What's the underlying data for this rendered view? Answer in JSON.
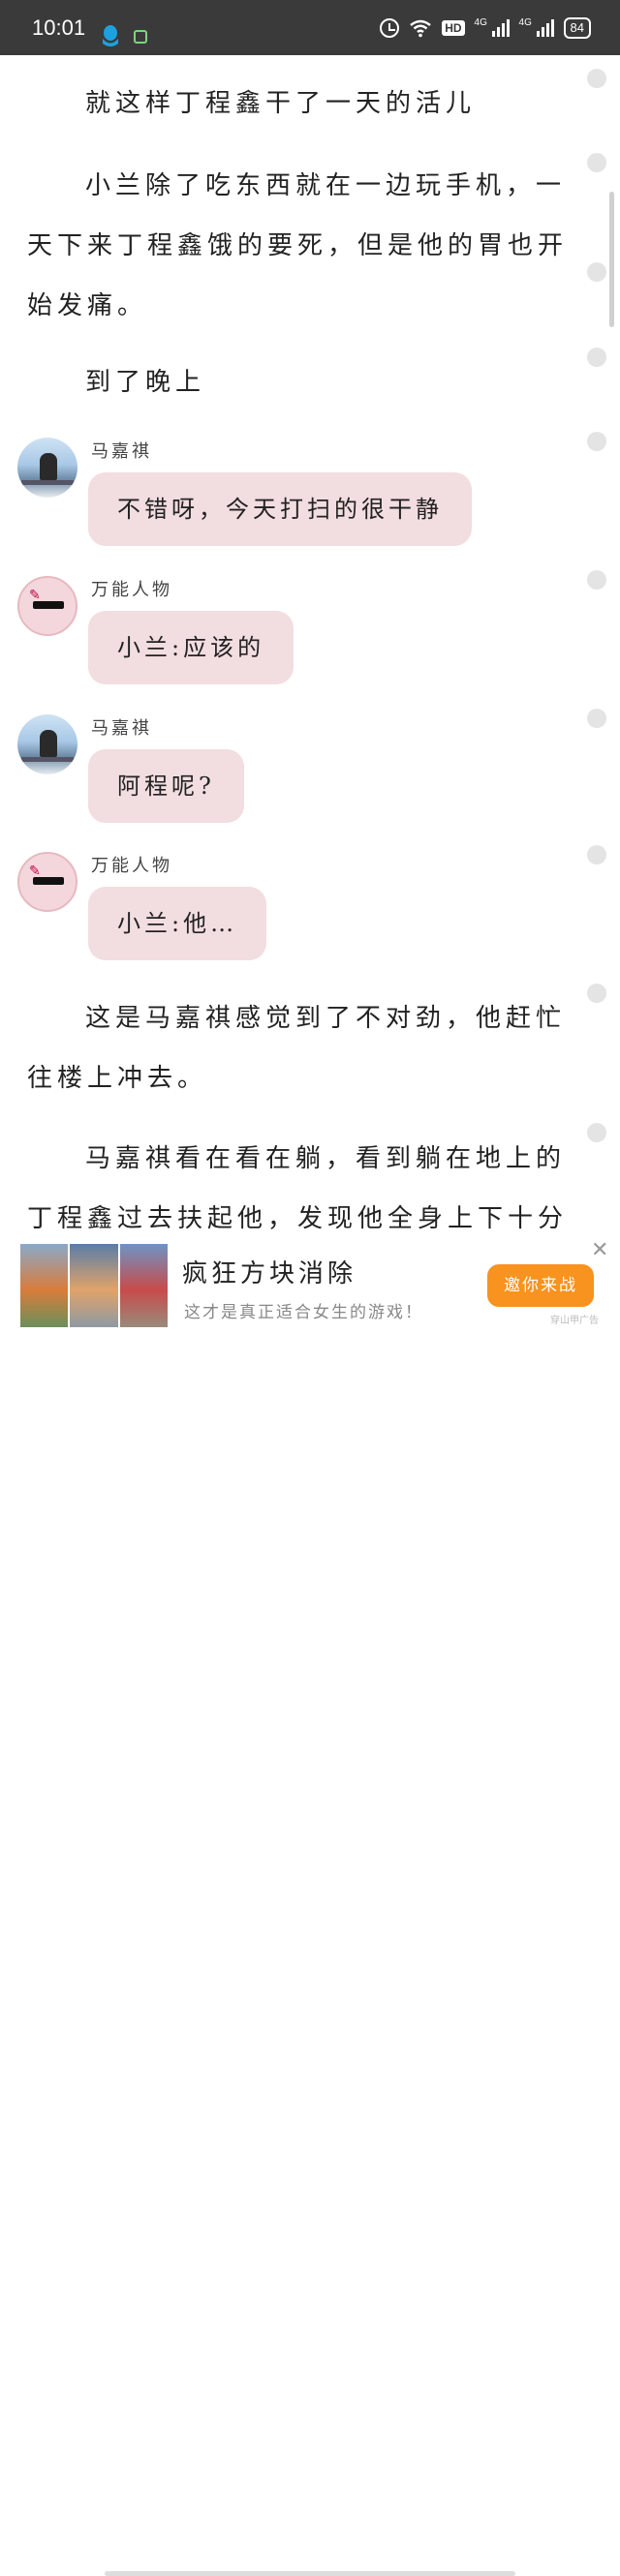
{
  "status_bar": {
    "time": "10:01",
    "hd_label": "HD",
    "network_1": "4G",
    "network_2": "4G",
    "battery": "84"
  },
  "story": {
    "paragraphs": [
      "就这样丁程鑫干了一天的活儿",
      "小兰除了吃东西就在一边玩手机，一天下来丁程鑫饿的要死，但是他的胃也开始发痛。",
      "到了晚上"
    ],
    "messages": [
      {
        "sender": "马嘉祺",
        "text": "不错呀，今天打扫的很干静",
        "avatar": "photo-avatar"
      },
      {
        "sender": "万能人物",
        "text": "小兰:应该的",
        "avatar": "sticker-avatar"
      },
      {
        "sender": "马嘉祺",
        "text": "阿程呢?",
        "avatar": "photo-avatar"
      },
      {
        "sender": "万能人物",
        "text": "小兰:他…",
        "avatar": "sticker-avatar"
      }
    ],
    "paragraphs_after": [
      "这是马嘉祺感觉到了不对劲，他赶忙往楼上冲去。",
      "马嘉祺看在看在躺，看到躺在地上的丁程鑫过去扶起他，发现他全身上下十分"
    ]
  },
  "ad": {
    "title": "疯狂方块消除",
    "subtitle": "这才是真正适合女生的游戏！",
    "cta": "邀你来战",
    "close": "✕",
    "source": "穿山甲广告"
  },
  "colors": {
    "status_bar_bg": "#3a3a3a",
    "bubble_bg": "#f2dde0",
    "ad_button": "#f7931e",
    "qq_icon": "#1ea0e0"
  }
}
